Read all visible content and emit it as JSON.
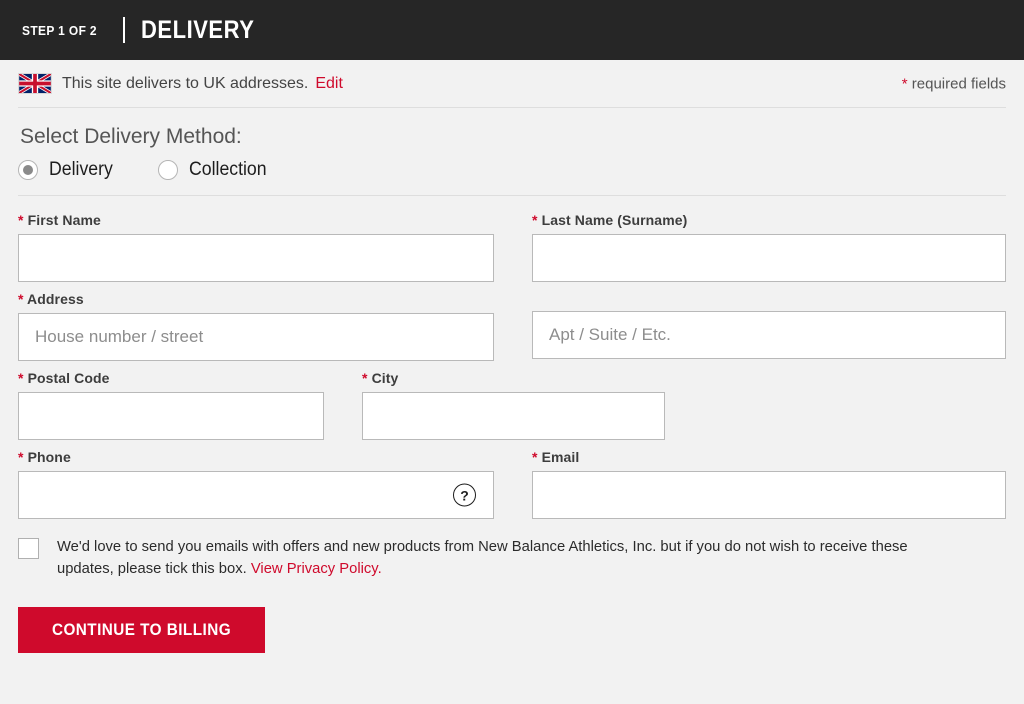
{
  "header": {
    "step_label": "STEP 1 OF 2",
    "title": "DELIVERY"
  },
  "notice": {
    "flag_icon": "uk-flag-icon",
    "text": "This site delivers to UK addresses.",
    "edit_label": "Edit",
    "required_star": "*",
    "required_text": "required fields"
  },
  "delivery_method": {
    "title": "Select Delivery Method:",
    "options": [
      {
        "label": "Delivery",
        "selected": true
      },
      {
        "label": "Collection",
        "selected": false
      }
    ]
  },
  "form": {
    "first_name": {
      "star": "*",
      "label": "First Name",
      "value": "",
      "placeholder": ""
    },
    "last_name": {
      "star": "*",
      "label": "Last Name (Surname)",
      "value": "",
      "placeholder": ""
    },
    "address": {
      "star": "*",
      "label": "Address",
      "value": "",
      "placeholder": "House number / street"
    },
    "address2": {
      "label": "",
      "value": "",
      "placeholder": "Apt / Suite / Etc."
    },
    "postal_code": {
      "star": "*",
      "label": "Postal Code",
      "value": "",
      "placeholder": ""
    },
    "city": {
      "star": "*",
      "label": "City",
      "value": "",
      "placeholder": ""
    },
    "phone": {
      "star": "*",
      "label": "Phone",
      "value": "",
      "placeholder": "",
      "help_icon": "question-mark-icon",
      "help_glyph": "?"
    },
    "email": {
      "star": "*",
      "label": "Email",
      "value": "",
      "placeholder": ""
    }
  },
  "optin": {
    "checked": false,
    "text": "We'd love to send you emails with offers and new products from New Balance Athletics, Inc. but if you do not wish to receive these updates, please tick this box.",
    "link_label": "View Privacy Policy."
  },
  "submit": {
    "label": "CONTINUE TO BILLING"
  },
  "colors": {
    "brand_red": "#cf0a2c",
    "header_dark": "#262626",
    "page_background": "#f2f2f2",
    "input_border": "#b9b9b9"
  }
}
